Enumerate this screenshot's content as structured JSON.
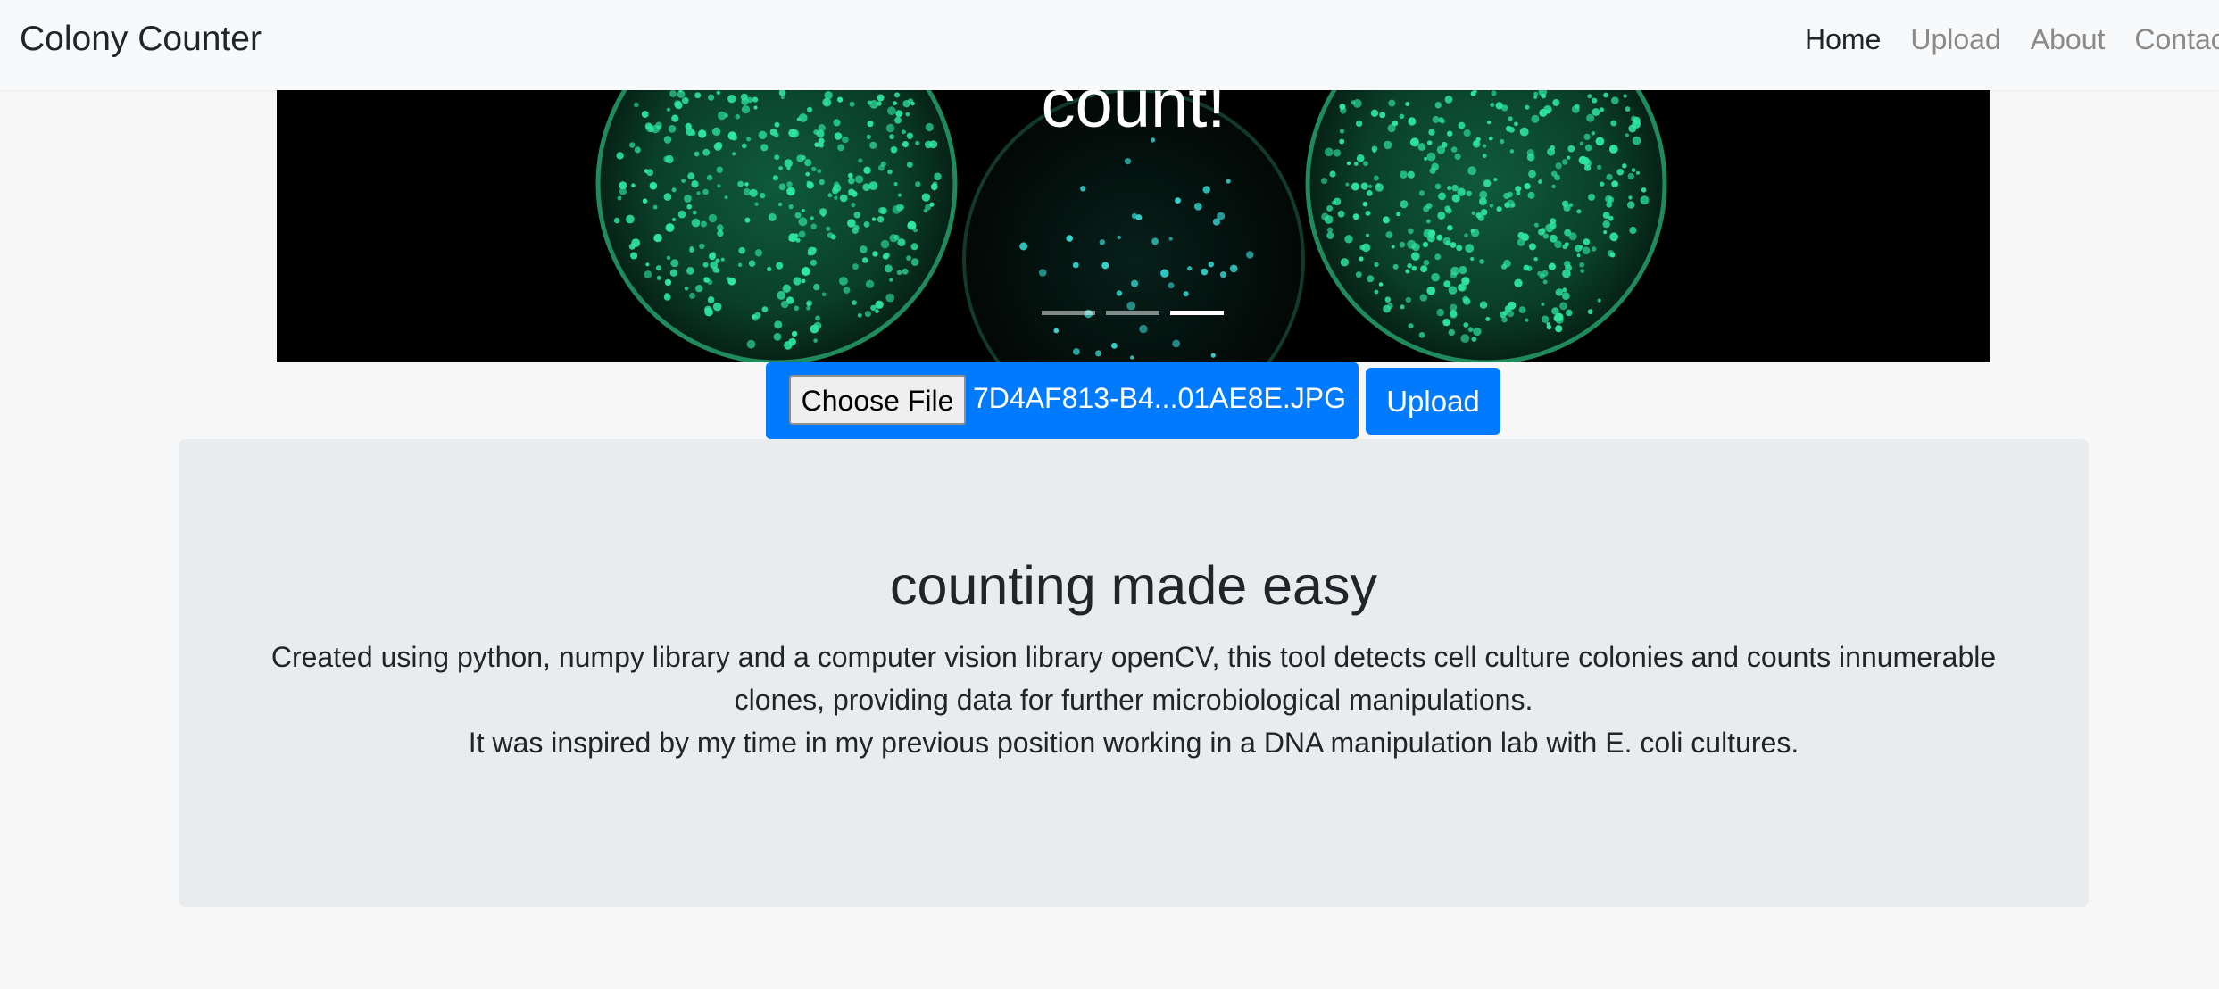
{
  "navbar": {
    "brand": "Colony Counter",
    "links": [
      {
        "label": "Home",
        "active": true
      },
      {
        "label": "Upload",
        "active": false
      },
      {
        "label": "About",
        "active": false
      },
      {
        "label": "Contac",
        "active": false
      }
    ]
  },
  "carousel": {
    "caption": "count!",
    "indicators": [
      {
        "active": false
      },
      {
        "active": false
      },
      {
        "active": true
      }
    ]
  },
  "upload": {
    "choose_file_label": "Choose File",
    "file_name": "7D4AF813-B4...01AE8E.JPG",
    "upload_label": "Upload"
  },
  "jumbotron": {
    "title": "counting made easy",
    "line1": "Created using python, numpy library and a computer vision library openCV, this tool detects cell culture colonies and counts innumerable",
    "line2": "clones, providing data for further microbiological manipulations.",
    "line3": "It was inspired by my time in my previous position working in a DNA manipulation lab with E. coli cultures."
  },
  "colors": {
    "accent": "#007bff",
    "navbar_bg": "#f8f9fa",
    "jumbotron_bg": "#e9ecef",
    "colony_green": "#2ee6a0"
  }
}
